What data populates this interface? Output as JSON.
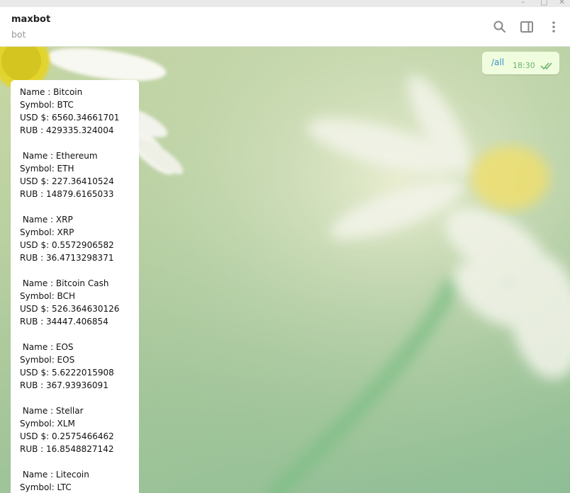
{
  "window": {
    "minimize_glyph": "–",
    "maximize_glyph": "□",
    "close_glyph": "✕"
  },
  "header": {
    "title": "maxbot",
    "subtitle": "bot",
    "icons": [
      "search-icon",
      "sidebar-toggle-icon",
      "more-vertical-icon"
    ]
  },
  "outgoing": {
    "text": "/all",
    "time": "18:30",
    "status_icon": "double-check-icon"
  },
  "incoming": {
    "coins": [
      {
        "name": "Name : Bitcoin",
        "symbol": "Symbol: BTC",
        "usd": "USD $: 6560.34661701",
        "rub": "RUB : 429335.324004"
      },
      {
        "name": " Name : Ethereum",
        "symbol": "Symbol: ETH",
        "usd": "USD $: 227.36410524",
        "rub": "RUB : 14879.6165033"
      },
      {
        "name": " Name : XRP",
        "symbol": "Symbol: XRP",
        "usd": "USD $: 0.5572906582",
        "rub": "RUB : 36.4713298371"
      },
      {
        "name": " Name : Bitcoin Cash",
        "symbol": "Symbol: BCH",
        "usd": "USD $: 526.364630126",
        "rub": "RUB : 34447.406854"
      },
      {
        "name": " Name : EOS",
        "symbol": "Symbol: EOS",
        "usd": "USD $: 5.6222015908",
        "rub": "RUB : 367.93936091"
      },
      {
        "name": " Name : Stellar",
        "symbol": "Symbol: XLM",
        "usd": "USD $: 0.2575466462",
        "rub": "RUB : 16.8548827142"
      },
      {
        "name": " Name : Litecoin",
        "symbol": "Symbol: LTC",
        "usd": "",
        "rub": ""
      }
    ]
  },
  "colors": {
    "accent_link": "#3a8fce",
    "outgoing_bubble": "#effdde",
    "read_ticks": "#6cb36c"
  }
}
